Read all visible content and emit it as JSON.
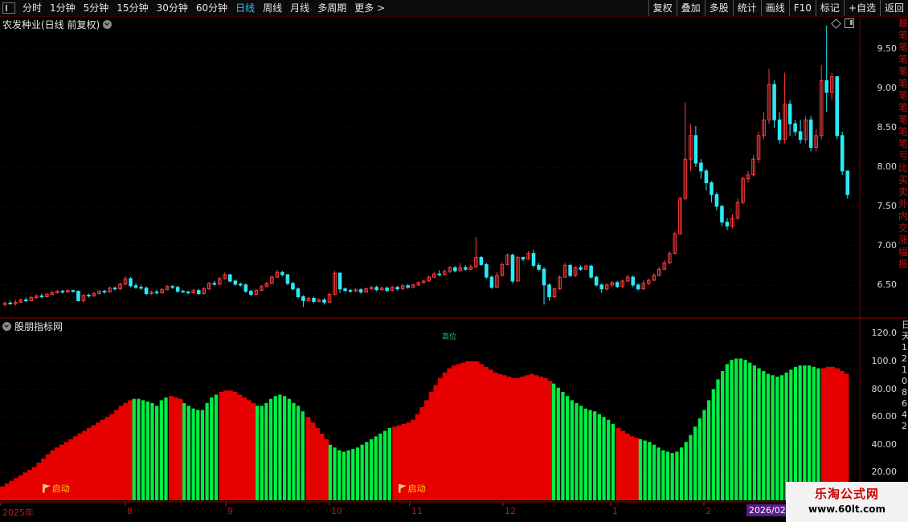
{
  "toolbar": {
    "left_items": [
      "分时",
      "1分钟",
      "5分钟",
      "15分钟",
      "30分钟",
      "60分钟",
      "日线",
      "周线",
      "月线",
      "多周期",
      "更多 >"
    ],
    "active_item": "日线",
    "right_items": [
      "复权",
      "叠加",
      "多股",
      "统计",
      "画线",
      "F10",
      "标记",
      "+自选",
      "返回"
    ]
  },
  "stock": {
    "title": "农发种业(日线 前复权)"
  },
  "price_axis": {
    "labels": [
      "9.50",
      "9.00",
      "8.50",
      "8.00",
      "7.50",
      "7.00",
      "6.50"
    ]
  },
  "indicator": {
    "title": "股朋指标网",
    "mid_label": "高位",
    "axis_labels": [
      "120.0",
      "100.0",
      "80.00",
      "60.00",
      "40.00",
      "20.00"
    ],
    "signal_text": "启动",
    "range": [
      0,
      130
    ]
  },
  "date_axis": {
    "labels": [
      "2025年",
      "8",
      "9",
      "10",
      "11",
      "12",
      "1",
      "2"
    ],
    "highlight": "2026/02/"
  },
  "right_strip_text": "最笔笔笔笔笔笔笔笔笔笔亏比买卖外内交涨幅振",
  "right_strip2_text": "日天12108642",
  "watermark": {
    "line1": "乐淘公式网",
    "line2": "www.60lt.com"
  },
  "colors": {
    "up": "#ff3b3b",
    "down": "#2ce8f5",
    "ind_red": "#e60000",
    "ind_green": "#00ee44",
    "grid": "#5a0000"
  },
  "chart_data": {
    "type": "candlestick",
    "price_range": [
      6.1,
      9.9
    ],
    "candles": [
      [
        6.25,
        6.27,
        6.29,
        6.23
      ],
      [
        6.27,
        6.26,
        6.3,
        6.25
      ],
      [
        6.26,
        6.28,
        6.31,
        6.24
      ],
      [
        6.28,
        6.31,
        6.33,
        6.27
      ],
      [
        6.31,
        6.3,
        6.34,
        6.28
      ],
      [
        6.3,
        6.34,
        6.36,
        6.29
      ],
      [
        6.34,
        6.36,
        6.38,
        6.32
      ],
      [
        6.36,
        6.35,
        6.39,
        6.33
      ],
      [
        6.35,
        6.38,
        6.4,
        6.34
      ],
      [
        6.38,
        6.4,
        6.43,
        6.37
      ],
      [
        6.4,
        6.42,
        6.44,
        6.39
      ],
      [
        6.42,
        6.41,
        6.44,
        6.39
      ],
      [
        6.41,
        6.43,
        6.45,
        6.4
      ],
      [
        6.43,
        6.42,
        6.44,
        6.4
      ],
      [
        6.42,
        6.3,
        6.43,
        6.29
      ],
      [
        6.3,
        6.37,
        6.38,
        6.28
      ],
      [
        6.37,
        6.36,
        6.39,
        6.34
      ],
      [
        6.36,
        6.39,
        6.41,
        6.35
      ],
      [
        6.39,
        6.42,
        6.44,
        6.38
      ],
      [
        6.42,
        6.41,
        6.44,
        6.39
      ],
      [
        6.41,
        6.46,
        6.48,
        6.4
      ],
      [
        6.46,
        6.45,
        6.48,
        6.43
      ],
      [
        6.45,
        6.51,
        6.53,
        6.44
      ],
      [
        6.51,
        6.58,
        6.61,
        6.5
      ],
      [
        6.58,
        6.49,
        6.6,
        6.47
      ],
      [
        6.49,
        6.47,
        6.52,
        6.45
      ],
      [
        6.47,
        6.46,
        6.5,
        6.44
      ],
      [
        6.46,
        6.39,
        6.48,
        6.37
      ],
      [
        6.39,
        6.41,
        6.43,
        6.37
      ],
      [
        6.41,
        6.4,
        6.44,
        6.38
      ],
      [
        6.4,
        6.44,
        6.46,
        6.39
      ],
      [
        6.44,
        6.48,
        6.5,
        6.43
      ],
      [
        6.48,
        6.47,
        6.5,
        6.45
      ],
      [
        6.47,
        6.42,
        6.49,
        6.4
      ],
      [
        6.42,
        6.41,
        6.44,
        6.4
      ],
      [
        6.41,
        6.4,
        6.43,
        6.38
      ],
      [
        6.4,
        6.43,
        6.45,
        6.39
      ],
      [
        6.43,
        6.39,
        6.45,
        6.37
      ],
      [
        6.39,
        6.45,
        6.47,
        6.38
      ],
      [
        6.45,
        6.52,
        6.54,
        6.44
      ],
      [
        6.52,
        6.51,
        6.55,
        6.49
      ],
      [
        6.51,
        6.58,
        6.6,
        6.5
      ],
      [
        6.58,
        6.63,
        6.66,
        6.57
      ],
      [
        6.63,
        6.55,
        6.64,
        6.53
      ],
      [
        6.55,
        6.51,
        6.57,
        6.49
      ],
      [
        6.51,
        6.5,
        6.53,
        6.48
      ],
      [
        6.5,
        6.42,
        6.52,
        6.4
      ],
      [
        6.42,
        6.38,
        6.44,
        6.36
      ],
      [
        6.38,
        6.43,
        6.45,
        6.37
      ],
      [
        6.43,
        6.48,
        6.5,
        6.42
      ],
      [
        6.48,
        6.52,
        6.54,
        6.47
      ],
      [
        6.52,
        6.6,
        6.62,
        6.51
      ],
      [
        6.6,
        6.66,
        6.69,
        6.59
      ],
      [
        6.66,
        6.63,
        6.68,
        6.61
      ],
      [
        6.63,
        6.52,
        6.64,
        6.5
      ],
      [
        6.52,
        6.45,
        6.54,
        6.43
      ],
      [
        6.45,
        6.35,
        6.47,
        6.33
      ],
      [
        6.35,
        6.3,
        6.37,
        6.22
      ],
      [
        6.3,
        6.33,
        6.35,
        6.28
      ],
      [
        6.33,
        6.29,
        6.35,
        6.27
      ],
      [
        6.29,
        6.31,
        6.33,
        6.28
      ],
      [
        6.31,
        6.28,
        6.33,
        6.25
      ],
      [
        6.28,
        6.38,
        6.4,
        6.27
      ],
      [
        6.38,
        6.65,
        6.68,
        6.37
      ],
      [
        6.65,
        6.45,
        6.66,
        6.4
      ],
      [
        6.45,
        6.43,
        6.47,
        6.41
      ],
      [
        6.43,
        6.42,
        6.45,
        6.4
      ],
      [
        6.42,
        6.44,
        6.46,
        6.41
      ],
      [
        6.44,
        6.41,
        6.46,
        6.39
      ],
      [
        6.41,
        6.45,
        6.47,
        6.4
      ],
      [
        6.45,
        6.47,
        6.49,
        6.44
      ],
      [
        6.47,
        6.44,
        6.49,
        6.42
      ],
      [
        6.44,
        6.46,
        6.48,
        6.43
      ],
      [
        6.46,
        6.43,
        6.48,
        6.41
      ],
      [
        6.43,
        6.47,
        6.49,
        6.42
      ],
      [
        6.47,
        6.45,
        6.49,
        6.43
      ],
      [
        6.45,
        6.49,
        6.51,
        6.44
      ],
      [
        6.49,
        6.47,
        6.51,
        6.45
      ],
      [
        6.47,
        6.5,
        6.52,
        6.46
      ],
      [
        6.5,
        6.53,
        6.55,
        6.49
      ],
      [
        6.53,
        6.55,
        6.57,
        6.52
      ],
      [
        6.55,
        6.6,
        6.62,
        6.54
      ],
      [
        6.6,
        6.64,
        6.67,
        6.59
      ],
      [
        6.64,
        6.63,
        6.69,
        6.61
      ],
      [
        6.63,
        6.67,
        6.7,
        6.62
      ],
      [
        6.67,
        6.72,
        6.74,
        6.65
      ],
      [
        6.72,
        6.68,
        6.74,
        6.66
      ],
      [
        6.68,
        6.72,
        6.78,
        6.67
      ],
      [
        6.72,
        6.7,
        6.75,
        6.68
      ],
      [
        6.7,
        6.73,
        6.76,
        6.69
      ],
      [
        6.73,
        6.85,
        7.11,
        6.72
      ],
      [
        6.85,
        6.76,
        6.87,
        6.74
      ],
      [
        6.76,
        6.6,
        6.78,
        6.58
      ],
      [
        6.6,
        6.47,
        6.62,
        6.45
      ],
      [
        6.47,
        6.62,
        6.66,
        6.46
      ],
      [
        6.62,
        6.76,
        6.79,
        6.61
      ],
      [
        6.76,
        6.88,
        6.9,
        6.75
      ],
      [
        6.88,
        6.55,
        6.9,
        6.52
      ],
      [
        6.55,
        6.85,
        6.87,
        6.54
      ],
      [
        6.85,
        6.83,
        6.86,
        6.8
      ],
      [
        6.83,
        6.9,
        6.93,
        6.82
      ],
      [
        6.9,
        6.75,
        6.95,
        6.72
      ],
      [
        6.75,
        6.7,
        6.78,
        6.68
      ],
      [
        6.7,
        6.5,
        6.73,
        6.25
      ],
      [
        6.5,
        6.35,
        6.52,
        6.3
      ],
      [
        6.35,
        6.45,
        6.47,
        6.33
      ],
      [
        6.45,
        6.6,
        6.62,
        6.44
      ],
      [
        6.6,
        6.75,
        6.78,
        6.59
      ],
      [
        6.75,
        6.62,
        6.77,
        6.6
      ],
      [
        6.62,
        6.72,
        6.74,
        6.6
      ],
      [
        6.72,
        6.7,
        6.75,
        6.68
      ],
      [
        6.7,
        6.74,
        6.76,
        6.69
      ],
      [
        6.74,
        6.6,
        6.76,
        6.58
      ],
      [
        6.6,
        6.5,
        6.62,
        6.48
      ],
      [
        6.5,
        6.45,
        6.52,
        6.4
      ],
      [
        6.45,
        6.5,
        6.52,
        6.43
      ],
      [
        6.5,
        6.53,
        6.55,
        6.48
      ],
      [
        6.53,
        6.48,
        6.55,
        6.46
      ],
      [
        6.48,
        6.55,
        6.57,
        6.46
      ],
      [
        6.55,
        6.6,
        6.63,
        6.54
      ],
      [
        6.6,
        6.5,
        6.62,
        6.47
      ],
      [
        6.5,
        6.45,
        6.52,
        6.43
      ],
      [
        6.45,
        6.52,
        6.56,
        6.44
      ],
      [
        6.52,
        6.56,
        6.58,
        6.5
      ],
      [
        6.56,
        6.62,
        6.65,
        6.55
      ],
      [
        6.62,
        6.7,
        6.73,
        6.61
      ],
      [
        6.7,
        6.78,
        6.82,
        6.69
      ],
      [
        6.78,
        6.9,
        6.93,
        6.77
      ],
      [
        6.9,
        7.15,
        7.18,
        6.89
      ],
      [
        7.15,
        7.6,
        7.62,
        7.14
      ],
      [
        7.6,
        8.1,
        8.82,
        7.58
      ],
      [
        8.1,
        8.4,
        8.55,
        7.95
      ],
      [
        8.4,
        8.05,
        8.52,
        8.0
      ],
      [
        8.05,
        7.95,
        8.1,
        7.85
      ],
      [
        7.95,
        7.8,
        7.98,
        7.7
      ],
      [
        7.8,
        7.65,
        7.82,
        7.55
      ],
      [
        7.65,
        7.5,
        7.68,
        7.45
      ],
      [
        7.5,
        7.3,
        7.52,
        7.25
      ],
      [
        7.3,
        7.25,
        7.35,
        7.2
      ],
      [
        7.25,
        7.35,
        7.4,
        7.22
      ],
      [
        7.35,
        7.55,
        7.6,
        7.33
      ],
      [
        7.55,
        7.85,
        7.88,
        7.53
      ],
      [
        7.85,
        7.9,
        7.95,
        7.8
      ],
      [
        7.9,
        8.1,
        8.15,
        7.88
      ],
      [
        8.1,
        8.4,
        8.45,
        8.05
      ],
      [
        8.4,
        8.6,
        8.7,
        8.35
      ],
      [
        8.6,
        9.05,
        9.25,
        8.55
      ],
      [
        9.05,
        8.6,
        9.1,
        8.5
      ],
      [
        8.6,
        8.35,
        8.7,
        8.3
      ],
      [
        8.35,
        8.8,
        9.2,
        8.3
      ],
      [
        8.8,
        8.55,
        8.85,
        8.4
      ],
      [
        8.55,
        8.45,
        8.6,
        8.4
      ],
      [
        8.45,
        8.35,
        8.6,
        8.3
      ],
      [
        8.35,
        8.6,
        8.65,
        8.3
      ],
      [
        8.6,
        8.25,
        8.65,
        8.2
      ],
      [
        8.25,
        8.4,
        8.48,
        8.2
      ],
      [
        8.4,
        9.1,
        9.3,
        8.35
      ],
      [
        9.1,
        8.95,
        9.8,
        8.7
      ],
      [
        8.95,
        9.15,
        9.2,
        8.85
      ],
      [
        9.15,
        8.4,
        9.15,
        8.35
      ],
      [
        8.4,
        7.95,
        8.45,
        7.9
      ],
      [
        7.95,
        7.65,
        7.95,
        7.6
      ]
    ],
    "indicator_values": [
      10,
      12,
      14,
      16,
      18,
      20,
      22,
      24,
      27,
      30,
      33,
      36,
      38,
      40,
      42,
      44,
      46,
      48,
      50,
      52,
      54,
      56,
      58,
      60,
      62,
      65,
      68,
      70,
      72,
      73,
      73,
      72,
      71,
      70,
      68,
      72,
      74,
      75,
      74,
      73,
      70,
      68,
      66,
      65,
      65,
      70,
      74,
      76,
      78,
      79,
      79,
      78,
      76,
      74,
      72,
      70,
      68,
      68,
      70,
      73,
      75,
      76,
      75,
      73,
      70,
      68,
      64,
      60,
      56,
      52,
      48,
      44,
      40,
      38,
      36,
      35,
      36,
      37,
      38,
      40,
      42,
      44,
      46,
      48,
      50,
      52,
      53,
      54,
      55,
      56,
      58,
      62,
      67,
      72,
      78,
      83,
      88,
      92,
      95,
      97,
      98,
      99,
      100,
      100,
      100,
      98,
      96,
      94,
      92,
      91,
      90,
      89,
      88,
      88,
      89,
      90,
      91,
      90,
      89,
      88,
      86,
      84,
      81,
      78,
      75,
      72,
      70,
      68,
      66,
      65,
      64,
      62,
      60,
      58,
      55,
      52,
      50,
      48,
      46,
      45,
      44,
      43,
      42,
      40,
      38,
      36,
      35,
      34,
      35,
      38,
      42,
      47,
      53,
      59,
      65,
      72,
      80,
      87,
      93,
      98,
      101,
      102,
      102,
      101,
      99,
      97,
      95,
      93,
      91,
      90,
      89,
      90,
      92,
      94,
      96,
      97,
      97,
      97,
      96,
      95,
      95,
      96,
      96,
      95,
      93,
      91
    ],
    "indicator_colors": "RRRRRRRRRRRRRRRRRRRRRRRRRRRRRGGGGGGGGRRRGGGGGGGGRRRRRRRRGGGGGGGGGGGRRRRRGGGGGGGGGGGGGGRRRRRRRRRRRRRRRRRRRRRRRRRRRRRRRRRRRGGGGGGGGGGGGGGRRRRRGGGGGGGGGGGGGGGGGGGGGGGGGGGGGGGGGGGGGGGGRRRRRRRRRRRRRRRRGGGGGGGGGGGRRRRRRRRRGGGGGRRGGGGG",
    "signals": [
      4,
      82
    ]
  }
}
